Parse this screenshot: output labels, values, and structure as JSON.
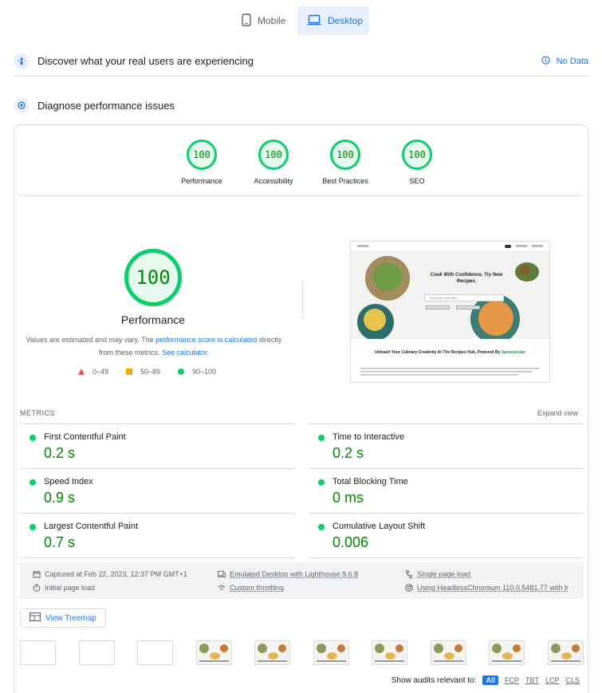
{
  "device_tabs": {
    "mobile": "Mobile",
    "desktop": "Desktop",
    "active": "desktop"
  },
  "field_data": {
    "title": "Discover what your real users are experiencing",
    "no_data": "No Data"
  },
  "diagnose": {
    "title": "Diagnose performance issues"
  },
  "categories": [
    {
      "label": "Performance",
      "score": "100"
    },
    {
      "label": "Accessibility",
      "score": "100"
    },
    {
      "label": "Best Practices",
      "score": "100"
    },
    {
      "label": "SEO",
      "score": "100"
    }
  ],
  "main": {
    "score": "100",
    "title": "Performance",
    "desc_prefix": "Values are estimated and may vary. The ",
    "desc_link1": "performance score is calculated",
    "desc_middle": " directly from these metrics. ",
    "desc_link2": "See calculator.",
    "legend": {
      "fail": "0–49",
      "average": "50–89",
      "pass": "90–100"
    }
  },
  "screenshot": {
    "hero_text": "Cook With Confidence, Try New Recipes.",
    "search_placeholder": "Find your next dish",
    "caption_prefix": "Unleash Your Culinary Creativity At The Recipes Hub, Powered By ",
    "caption_brand": "Spoonacular"
  },
  "metrics": {
    "heading": "METRICS",
    "expand": "Expand view",
    "items": [
      {
        "title": "First Contentful Paint",
        "value": "0.2 s"
      },
      {
        "title": "Time to Interactive",
        "value": "0.2 s"
      },
      {
        "title": "Speed Index",
        "value": "0.9 s"
      },
      {
        "title": "Total Blocking Time",
        "value": "0 ms"
      },
      {
        "title": "Largest Contentful Paint",
        "value": "0.7 s"
      },
      {
        "title": "Cumulative Layout Shift",
        "value": "0.006"
      }
    ]
  },
  "runtime": {
    "captured": "Captured at Feb 22, 2023, 12:37 PM GMT+1",
    "initial": "Initial page load",
    "emulated": "Emulated Desktop with Lighthouse 9.6.8",
    "throttling": "Custom throttling",
    "single": "Single page load",
    "browser": "Using HeadlessChromium 110.0.5481.77 with lr"
  },
  "treemap": {
    "label": "View Treemap"
  },
  "audits": {
    "label": "Show audits relevant to:",
    "chips": [
      "All",
      "FCP",
      "TBT",
      "LCP",
      "CLS"
    ]
  },
  "colors": {
    "pass": "#0cce6b",
    "pass_text": "#008800",
    "accent": "#1a73e8",
    "average": "#ffa400",
    "fail": "#ff4e42"
  }
}
